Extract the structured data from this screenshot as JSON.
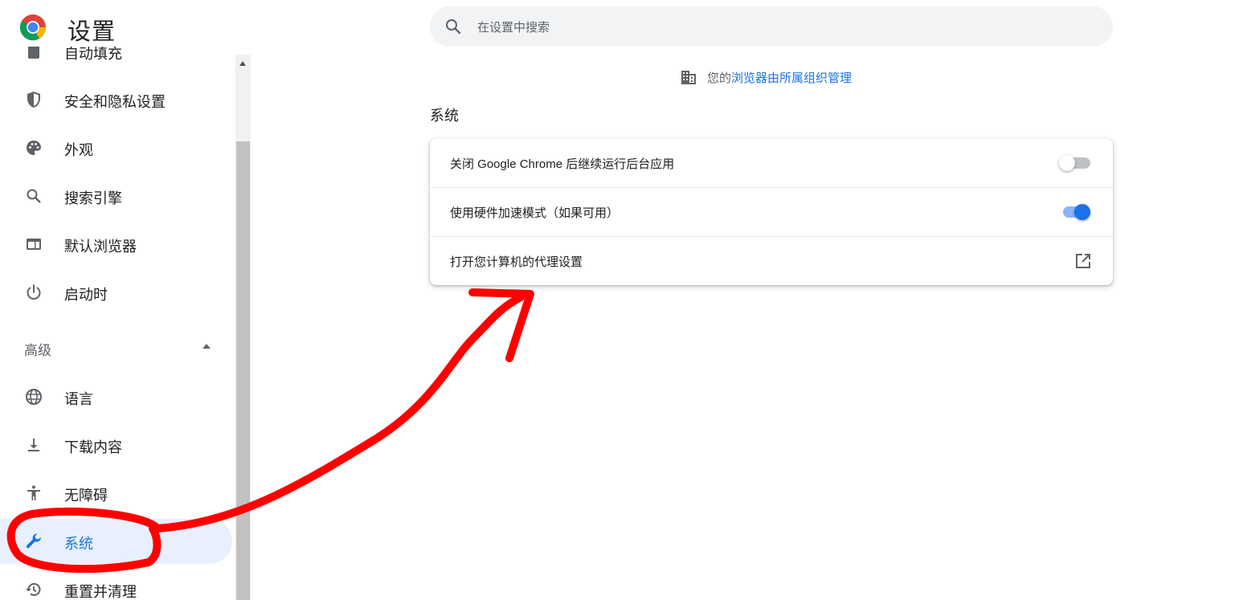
{
  "header": {
    "title": "设置",
    "search_placeholder": "在设置中搜索",
    "logo_icon": "chrome-logo-icon",
    "search_icon": "search-icon"
  },
  "sidebar": {
    "items": [
      {
        "label": "自动填充",
        "icon": "clipboard-icon"
      },
      {
        "label": "安全和隐私设置",
        "icon": "shield-icon"
      },
      {
        "label": "外观",
        "icon": "palette-icon"
      },
      {
        "label": "搜索引擎",
        "icon": "search-icon"
      },
      {
        "label": "默认浏览器",
        "icon": "browser-window-icon"
      },
      {
        "label": "启动时",
        "icon": "power-icon"
      }
    ],
    "advanced_label": "高级",
    "advanced_items": [
      {
        "label": "语言",
        "icon": "globe-icon"
      },
      {
        "label": "下载内容",
        "icon": "download-icon"
      },
      {
        "label": "无障碍",
        "icon": "accessibility-icon"
      },
      {
        "label": "系统",
        "icon": "wrench-icon",
        "active": true
      },
      {
        "label": "重置并清理",
        "icon": "restore-icon"
      }
    ]
  },
  "main": {
    "managed_prefix": "您的",
    "managed_link": "浏览器由所属组织管理",
    "section_title": "系统",
    "rows": [
      {
        "label": "关闭 Google Chrome 后继续运行后台应用",
        "control": "toggle",
        "state": "off"
      },
      {
        "label": "使用硬件加速模式（如果可用）",
        "control": "toggle",
        "state": "on"
      },
      {
        "label": "打开您计算机的代理设置",
        "control": "external-link",
        "icon": "open-in-new-icon"
      }
    ]
  },
  "colors": {
    "accent": "#1a73e8",
    "active_bg": "#e8f0fe",
    "annotation": "#ff0000"
  }
}
